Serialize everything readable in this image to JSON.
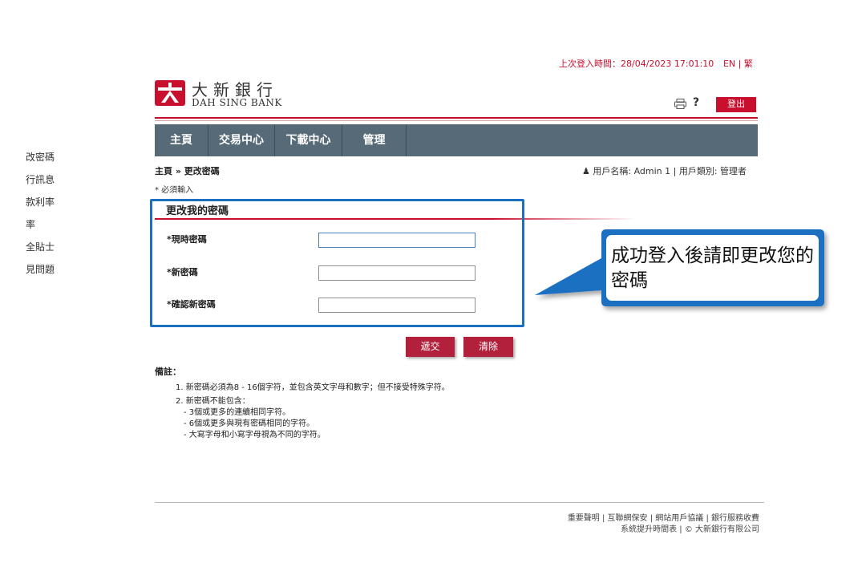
{
  "sidebar": {
    "items": [
      "改密碼",
      "行訊息",
      "款利率",
      "率",
      "全貼士",
      "見問題"
    ]
  },
  "header": {
    "last_login_label": "上次登入時間：",
    "last_login_time": "28/04/2023 17:01:10",
    "lang_links": "EN | 繁",
    "logo_cn": "大新銀行",
    "logo_en": "DAH SING BANK",
    "help": "?",
    "logout": "登出"
  },
  "nav": {
    "items": [
      "主頁",
      "交易中心",
      "下載中心",
      "管理"
    ]
  },
  "breadcrumb": "主頁 » 更改密碼",
  "user_info": "用戶名稱: Admin 1 | 用戶類別: 管理者",
  "required_note": "* 必須輸入",
  "form": {
    "title": "更改我的密碼",
    "fields": [
      {
        "label": "*現時密碼",
        "value": ""
      },
      {
        "label": "*新密碼",
        "value": ""
      },
      {
        "label": "*確認新密碼",
        "value": ""
      }
    ],
    "submit": "遞交",
    "clear": "清除"
  },
  "callout": {
    "text": "成功登入後請即更改您的密碼"
  },
  "notes": {
    "title": "備註：",
    "items": [
      "1. 新密碼必須為8 - 16個字符，並包含英文字母和數字；但不接受特殊字符。",
      "2. 新密碼不能包含：",
      "- 3個或更多的連續相同字符。",
      "- 6個或更多與現有密碼相同的字符。",
      "- 大寫字母和小寫字母視為不同的字符。"
    ]
  },
  "footer": {
    "line1": "重要聲明 | 互聯網保安 | 網站用戶協議 | 銀行服務收費",
    "line2": "系統提升時間表 | © 大新銀行有限公司"
  },
  "colors": {
    "brand_red": "#c8102e",
    "nav_bg": "#566a77",
    "highlight_blue": "#1d6fc2"
  }
}
